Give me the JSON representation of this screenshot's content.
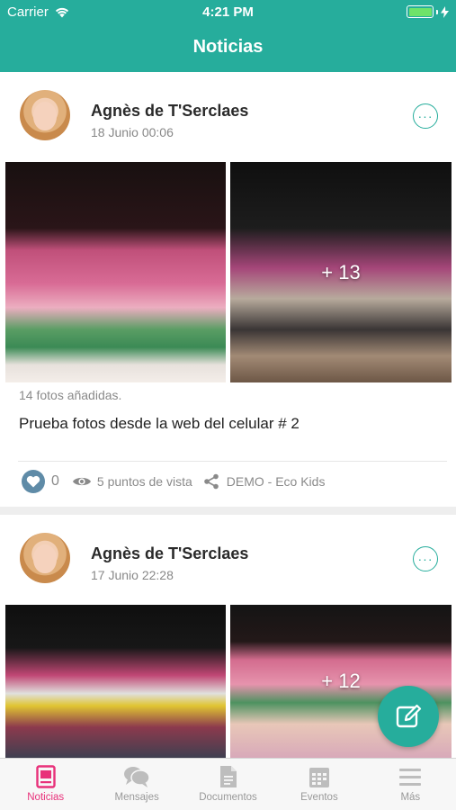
{
  "status_bar": {
    "carrier": "Carrier",
    "time": "4:21 PM"
  },
  "header": {
    "title": "Noticias"
  },
  "posts": [
    {
      "author": "Agnès de T'Serclaes",
      "date": "18 Junio 00:06",
      "more_overflow": "+ 13",
      "photo_count_text": "14 fotos añadidas.",
      "caption": "Prueba fotos desde la web del celular # 2",
      "likes": "0",
      "views": "5 puntos de vista",
      "shared_with": "DEMO - Eco Kids"
    },
    {
      "author": "Agnès de T'Serclaes",
      "date": "17 Junio 22:28",
      "more_overflow": "+ 12"
    }
  ],
  "tabs": [
    {
      "label": "Noticias",
      "icon": "news-icon",
      "active": true
    },
    {
      "label": "Mensajes",
      "icon": "chat-icon",
      "active": false
    },
    {
      "label": "Documentos",
      "icon": "document-icon",
      "active": false
    },
    {
      "label": "Eventos",
      "icon": "calendar-icon",
      "active": false
    },
    {
      "label": "Más",
      "icon": "menu-icon",
      "active": false
    }
  ],
  "colors": {
    "brand": "#26ad9c",
    "active_tab": "#e8317a",
    "like": "#5f8ba7"
  }
}
